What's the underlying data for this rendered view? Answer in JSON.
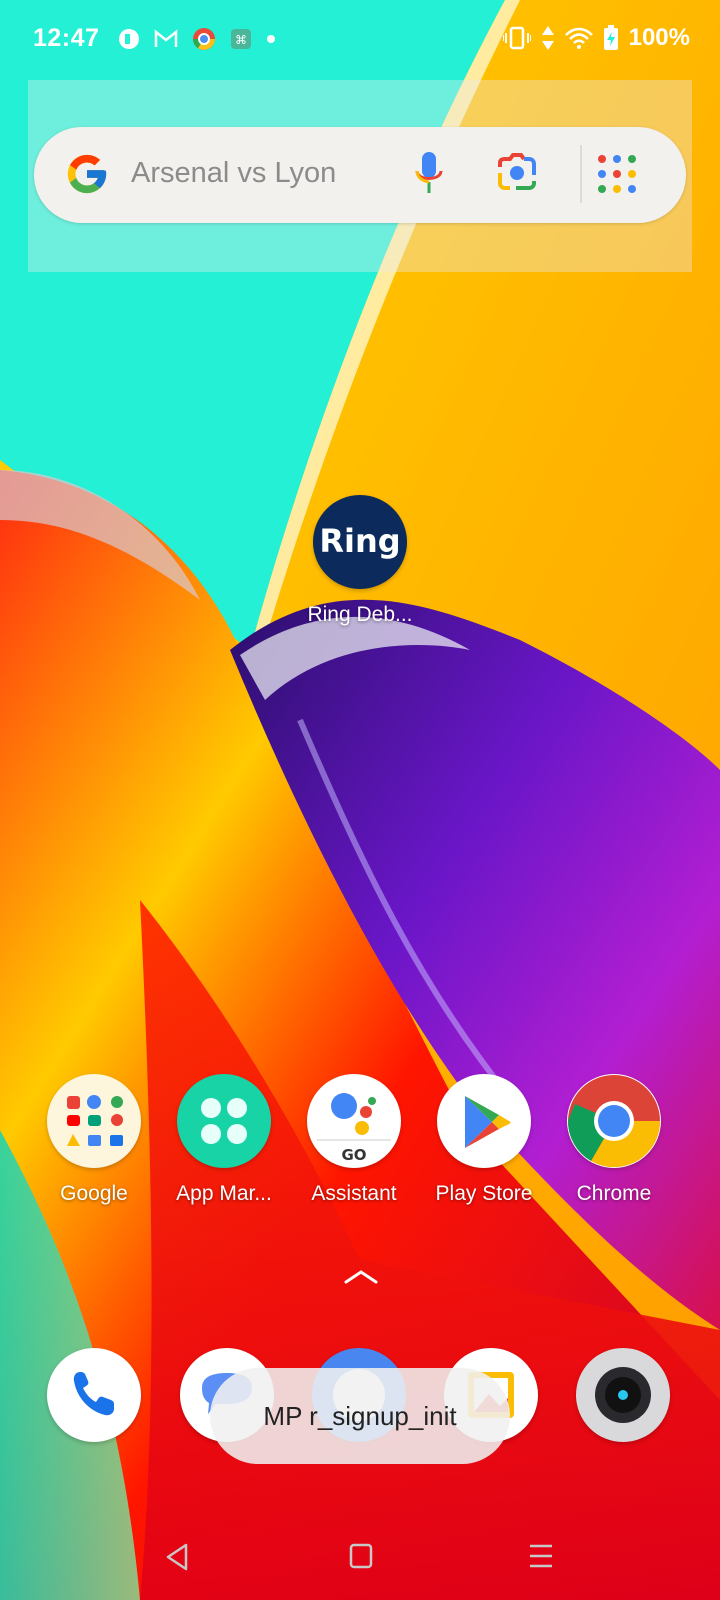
{
  "status_bar": {
    "time": "12:47",
    "notification_icons": [
      "ring-notif-icon",
      "gmail-icon",
      "chrome-notif-icon",
      "app-notif-icon",
      "more-dot-icon"
    ],
    "right_icons": [
      "vibrate-icon",
      "data-arrows-icon",
      "wifi-icon",
      "battery-charging-icon"
    ],
    "battery": "100%"
  },
  "search_widget": {
    "query": "Arsenal vs Lyon",
    "icons": [
      "google-g-icon",
      "mic-icon",
      "lens-icon",
      "apps-grid-icon"
    ]
  },
  "home_apps": [
    {
      "label": "Ring Deb...",
      "icon": "ring-icon",
      "color": "#0c2a5b"
    }
  ],
  "app_row": [
    {
      "label": "Google",
      "icon": "google-folder-icon"
    },
    {
      "label": "App Mar...",
      "icon": "app-market-icon",
      "color": "#18d3a6"
    },
    {
      "label": "Assistant",
      "icon": "assistant-go-icon"
    },
    {
      "label": "Play Store",
      "icon": "play-store-icon"
    },
    {
      "label": "Chrome",
      "icon": "chrome-icon"
    }
  ],
  "dock": [
    {
      "icon": "phone-icon"
    },
    {
      "icon": "messages-icon"
    },
    {
      "icon": "chat-bubble-icon"
    },
    {
      "icon": "gallery-icon"
    },
    {
      "icon": "camera-icon"
    }
  ],
  "toast": {
    "text": "MP r_signup_init"
  },
  "nav_bar": [
    "back-icon",
    "home-icon",
    "recents-icon"
  ]
}
